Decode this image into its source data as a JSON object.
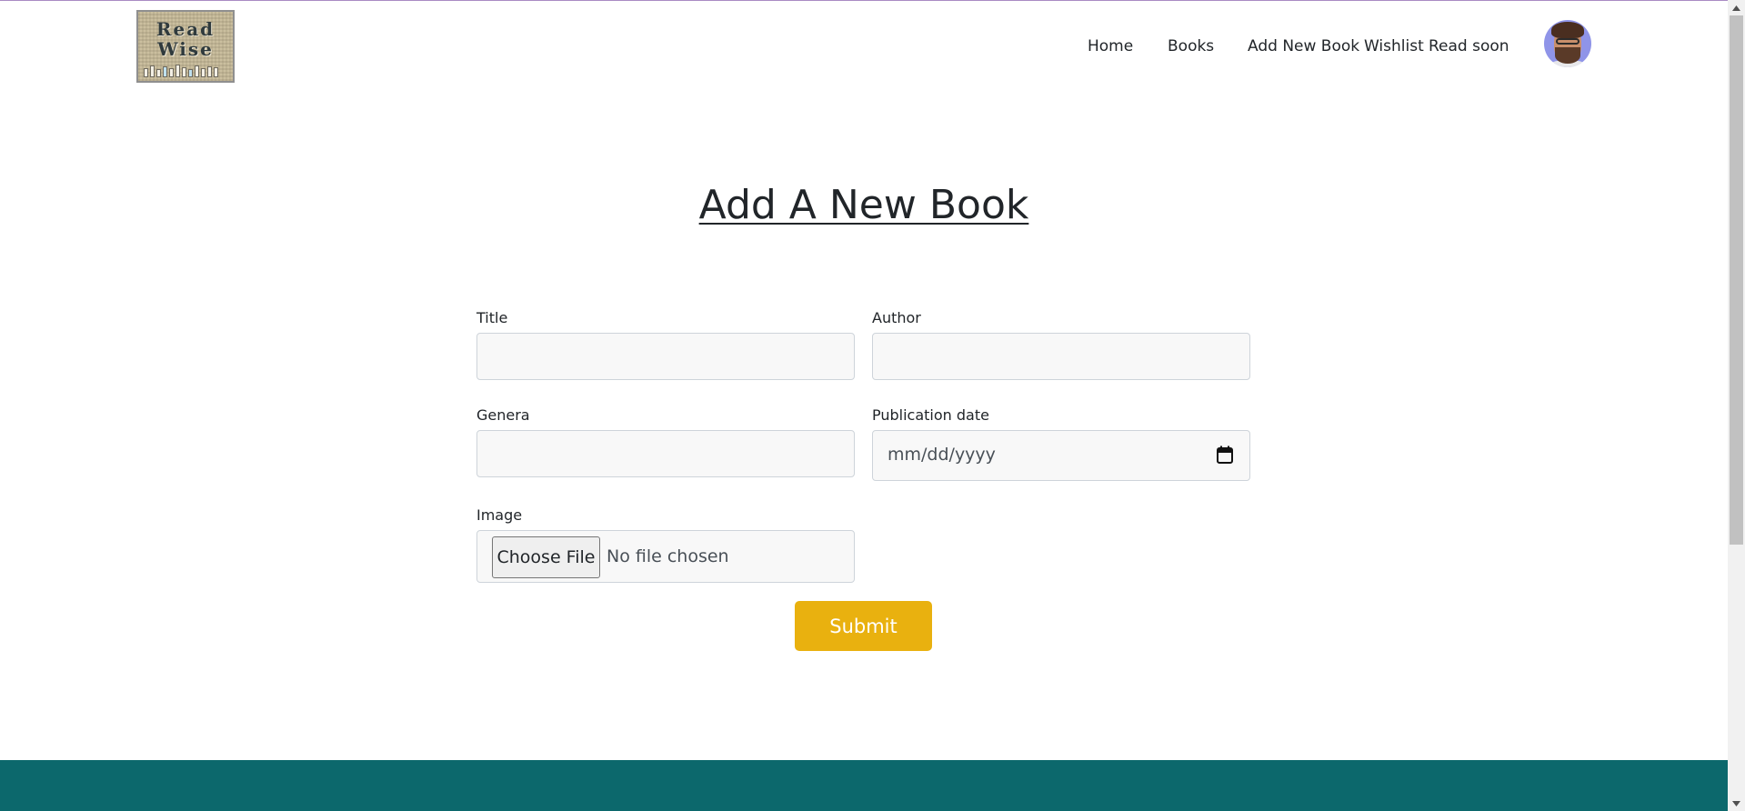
{
  "brand": {
    "logo_text_line1": "Read",
    "logo_text_line2": "Wise"
  },
  "nav": {
    "items": [
      {
        "label": "Home"
      },
      {
        "label": "Books"
      },
      {
        "label": "Add New Book"
      },
      {
        "label": "Wishlist"
      },
      {
        "label": "Read soon"
      }
    ]
  },
  "page": {
    "heading": "Add A New Book"
  },
  "form": {
    "title_label": "Title",
    "author_label": "Author",
    "genera_label": "Genera",
    "publication_date_label": "Publication date",
    "publication_date_placeholder": "mm/dd/yyyy",
    "image_label": "Image",
    "choose_file_label": "Choose File",
    "file_status": "No file chosen",
    "submit_label": "Submit"
  },
  "colors": {
    "submit": "#e9b10f",
    "footer": "#0c686c",
    "avatar_bg": "#8f94e8"
  }
}
